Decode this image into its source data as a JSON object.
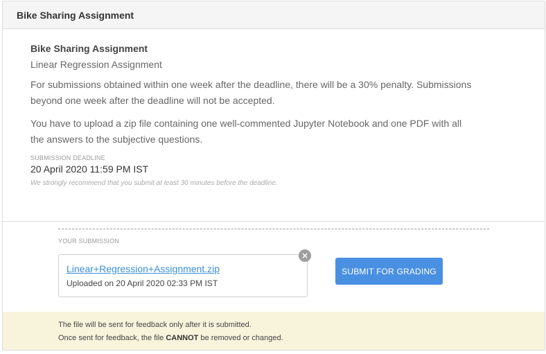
{
  "header": {
    "title": "Bike Sharing Assignment"
  },
  "assignment": {
    "name": "Bike Sharing Assignment",
    "subtitle": "Linear Regression Assignment",
    "paragraph1": "For submissions obtained within one week after the deadline, there will be a 30% penalty. Submissions beyond one week after the deadline will not be accepted.",
    "paragraph2": "You have to upload a zip file containing one well-commented Jupyter Notebook and one PDF with all the answers to the subjective questions.",
    "deadline_label": "SUBMISSION DEADLINE",
    "deadline_value": "20 April 2020 11:59 PM IST",
    "deadline_note": "We strongly recommend that you submit at least 30 minutes before the deadline."
  },
  "submission": {
    "label": "YOUR SUBMISSION",
    "file_name": "Linear+Regression+Assignment.zip",
    "uploaded_text": "Uploaded on 20 April 2020 02:33 PM IST",
    "remove_glyph": "×",
    "submit_label": "SUBMIT FOR GRADING"
  },
  "notice": {
    "line1": "The file will be sent for feedback only after it is submitted.",
    "line2_prefix": "Once sent for feedback, the file ",
    "line2_bold": "CANNOT",
    "line2_suffix": " be removed or changed."
  },
  "colors": {
    "accent": "#4a90e2",
    "link": "#3a8fd9",
    "notice_bg": "#f8f4dc",
    "header_bg": "#f5f5f5"
  },
  "icons": {
    "remove": "close-icon"
  }
}
